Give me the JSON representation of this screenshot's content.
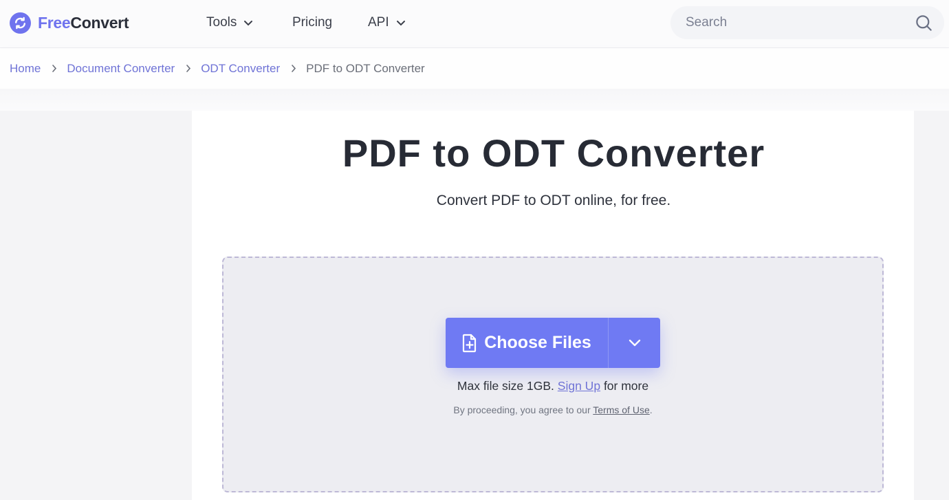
{
  "brand": {
    "name_part1": "Free",
    "name_part2": "Convert",
    "accent_color": "#6f73ee",
    "logo_icon": "sync-arrows-icon"
  },
  "nav": {
    "items": [
      {
        "label": "Tools",
        "has_dropdown": true
      },
      {
        "label": "Pricing",
        "has_dropdown": false
      },
      {
        "label": "API",
        "has_dropdown": true
      }
    ]
  },
  "search": {
    "placeholder": "Search",
    "value": "",
    "icon": "search-icon"
  },
  "breadcrumb": {
    "items": [
      {
        "label": "Home",
        "link": true
      },
      {
        "label": "Document Converter",
        "link": true
      },
      {
        "label": "ODT Converter",
        "link": true
      },
      {
        "label": "PDF to ODT Converter",
        "link": false
      }
    ]
  },
  "main": {
    "title": "PDF to ODT Converter",
    "subtitle": "Convert PDF to ODT online, for free.",
    "upload": {
      "button_label": "Choose Files",
      "button_icon": "file-plus-icon",
      "dropdown_icon": "chevron-down-icon",
      "button_color": "#6f7af3",
      "limit_prefix": "Max file size 1GB.",
      "signup_link": "Sign Up",
      "limit_suffix": "for more",
      "terms_prefix": "By proceeding, you agree to our",
      "terms_link": "Terms of Use",
      "terms_suffix": "."
    }
  }
}
